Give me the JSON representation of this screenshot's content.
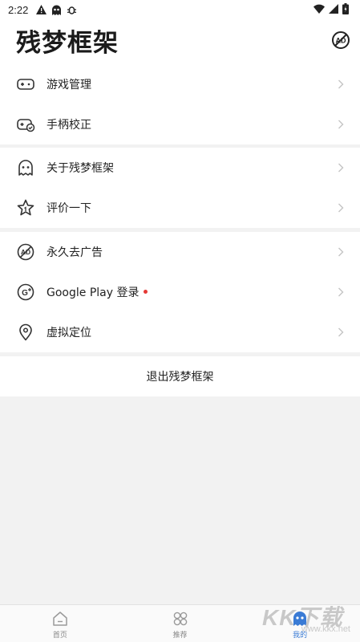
{
  "status_bar": {
    "time": "2:22",
    "icons": [
      "warning-icon",
      "ghost-icon",
      "bug-icon"
    ],
    "right_icons": [
      "wifi-icon",
      "signal-icon",
      "battery-icon"
    ]
  },
  "header": {
    "title": "残梦框架",
    "ad_icon": "no-ads-icon"
  },
  "groups": [
    {
      "items": [
        {
          "label": "游戏管理",
          "icon": "gamepad-icon"
        },
        {
          "label": "手柄校正",
          "icon": "controller-calibrate-icon"
        }
      ]
    },
    {
      "items": [
        {
          "label": "关于残梦框架",
          "icon": "ghost-icon"
        },
        {
          "label": "评价一下",
          "icon": "star-icon"
        }
      ]
    },
    {
      "items": [
        {
          "label": "永久去广告",
          "icon": "no-ads-icon"
        },
        {
          "label": "Google Play 登录",
          "icon": "google-plus-icon",
          "has_dot": true,
          "dot_color": "#e53935"
        },
        {
          "label": "虚拟定位",
          "icon": "location-pin-icon"
        }
      ]
    }
  ],
  "logout": {
    "label": "退出残梦框架"
  },
  "tabbar": {
    "tabs": [
      {
        "label": "首页",
        "icon": "home-icon",
        "active": false
      },
      {
        "label": "推荐",
        "icon": "clover-icon",
        "active": false
      },
      {
        "label": "我的",
        "icon": "ghost-icon",
        "active": true
      }
    ]
  },
  "watermark": {
    "big": "KK下载",
    "small": "www.kkx.net"
  },
  "colors": {
    "accent": "#3a7bd5",
    "background": "#f2f2f2",
    "dot": "#e53935"
  }
}
